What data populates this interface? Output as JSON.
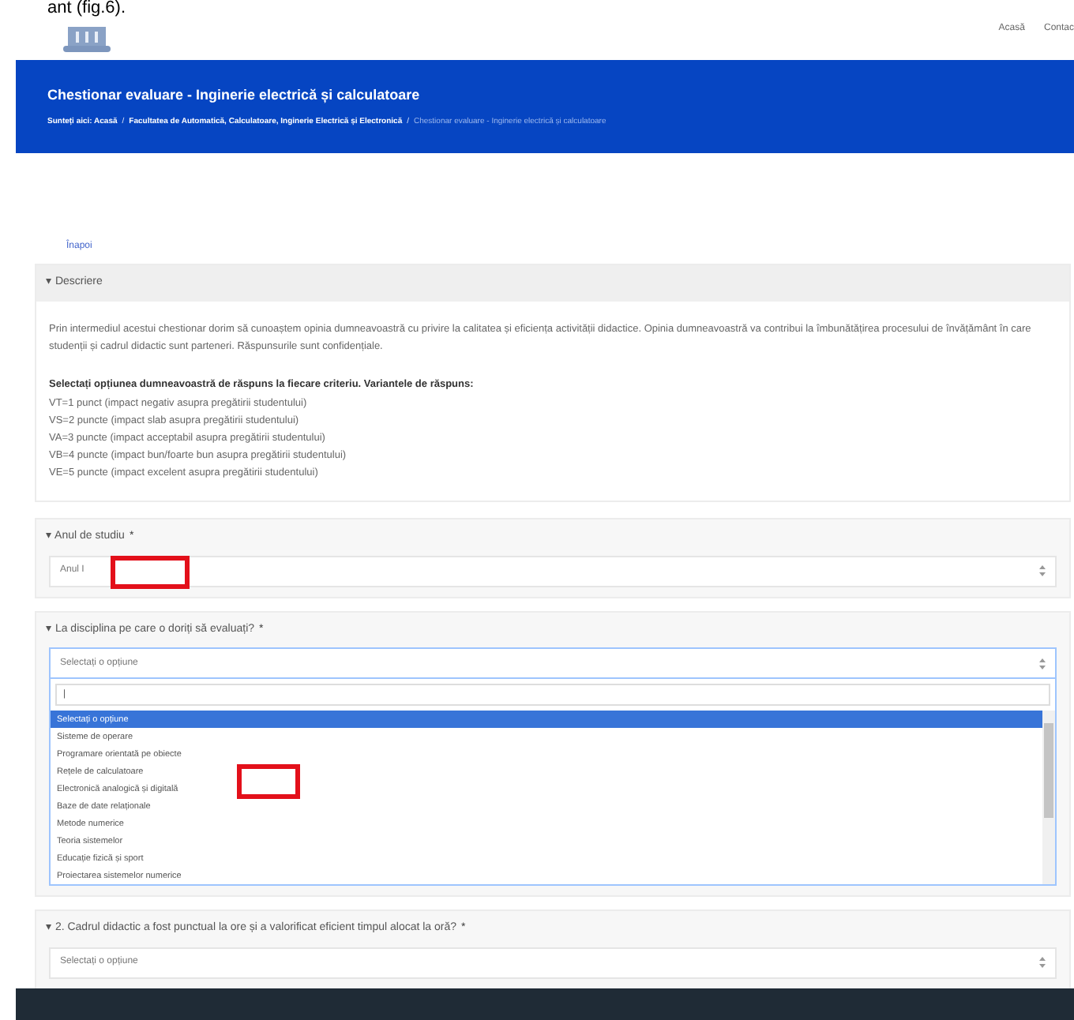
{
  "caption_fragment": "ant (fig.6).",
  "top_nav": [
    {
      "label": "Acasă"
    },
    {
      "label": "Contac"
    }
  ],
  "banner": {
    "separator": "/",
    "title": "Chestionar evaluare - Inginerie electrică și calculatoare",
    "breadcrumb": [
      {
        "label": "Sunteți aici: Acasă",
        "current": false
      },
      {
        "label": "Facultatea de Automatică, Calculatoare, Inginerie Electrică și Electronică",
        "current": false
      },
      {
        "label": "Chestionar evaluare - Inginerie electrică și calculatoare",
        "current": true
      }
    ]
  },
  "back_link": "Înapoi",
  "description": {
    "title": "▾ Descriere",
    "expanded": true,
    "paragraph": "Prin intermediul acestui chestionar dorim să cunoaștem opinia dumneavoastră cu privire la calitatea și eficiența activității didactice. Opinia dumneavoastră va contribui la îmbunătățirea procesului de învățământ în care studenții și cadrul didactic sunt parteneri. Răspunsurile sunt confidențiale.",
    "instruction": "Selectați opțiunea dumneavoastră de răspuns la fiecare criteriu. Variantele de răspuns:",
    "scale": [
      "VT=1 punct (impact negativ asupra pregătirii studentului)",
      "VS=2 puncte (impact slab asupra pregătirii studentului)",
      "VA=3 puncte (impact acceptabil asupra pregătirii studentului)",
      "VB=4 puncte (impact bun/foarte bun asupra pregătirii studentului)",
      "VE=5 puncte (impact excelent asupra pregătirii studentului)"
    ]
  },
  "questions": [
    {
      "label": "▾ Anul de studiu",
      "required": "*",
      "value": "Anul I",
      "open": false
    },
    {
      "label": "▾ La disciplina pe care o doriți să evaluați?",
      "required": "*",
      "value": "Selectați o opțiune",
      "open": true,
      "search_value": "|",
      "options": [
        {
          "label": "Selectați o opțiune",
          "selected": true
        },
        {
          "label": "Sisteme de operare",
          "selected": false
        },
        {
          "label": "Programare orientată pe obiecte",
          "selected": false
        },
        {
          "label": "Rețele de calculatoare",
          "selected": false
        },
        {
          "label": "Electronică analogică și digitală",
          "selected": false
        },
        {
          "label": "Baze de date relaționale",
          "selected": false
        },
        {
          "label": "Metode numerice",
          "selected": false
        },
        {
          "label": "Teoria sistemelor",
          "selected": false
        },
        {
          "label": "Educație fizică și sport",
          "selected": false
        },
        {
          "label": "Proiectarea sistemelor numerice",
          "selected": false
        }
      ]
    },
    {
      "label": "▾ 2. Cadrul didactic a fost punctual la ore și a valorificat eficient timpul alocat la oră?",
      "required": "*",
      "value": "Selectați o opțiune",
      "open": false
    }
  ]
}
